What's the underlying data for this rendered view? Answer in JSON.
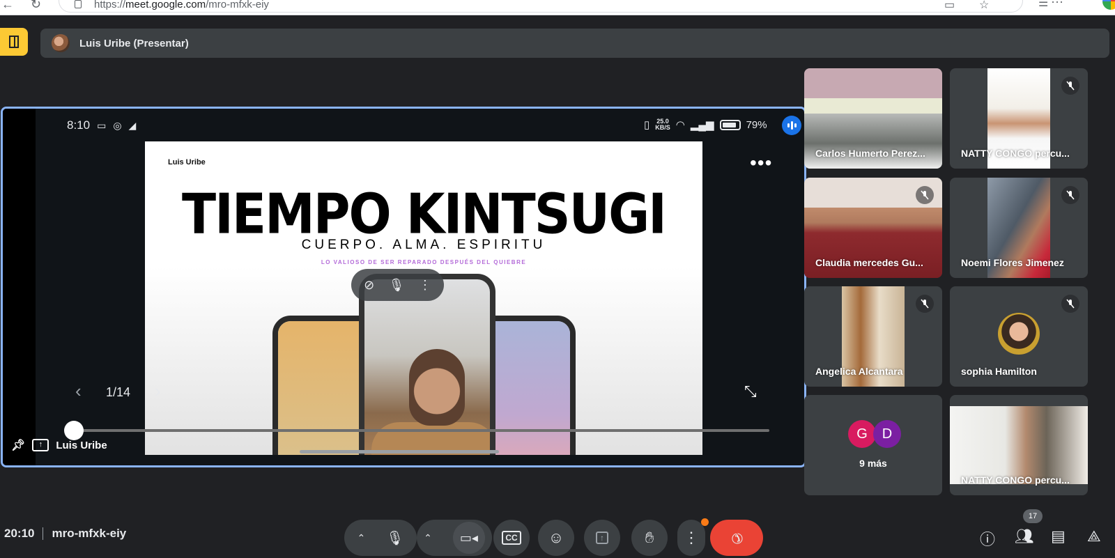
{
  "browser": {
    "url_prefix": "https://",
    "url_host": "meet.google.com",
    "url_path": "/mro-mfxk-eiy"
  },
  "presenter_bar": {
    "label": "Luis Uribe (Presentar)"
  },
  "presentation": {
    "phone_time": "8:10",
    "net_speed_top": "25.0",
    "net_speed_unit": "KB/S",
    "battery": "79%",
    "slide_author": "Luis Uribe",
    "slide_title": "TIEMPO KINTSUGI",
    "slide_subtitle": "CUERPO. ALMA. ESPIRITU",
    "slide_tagline": "LO VALIOSO DE SER REPARADO DESPUÉS DEL QUIEBRE",
    "page_indicator": "1/14",
    "tile_name": "Luis Uribe"
  },
  "participants": [
    {
      "name": "Carlos Humerto Perez...",
      "muted": false
    },
    {
      "name": "NATTY CONGO percu...",
      "muted": true
    },
    {
      "name": "Claudia mercedes Gu...",
      "muted": true
    },
    {
      "name": "Noemi Flores Jimenez",
      "muted": true
    },
    {
      "name": "Angelica Alcantara",
      "muted": true
    },
    {
      "name": "sophia Hamilton",
      "muted": true
    },
    {
      "name": "NATTY CONGO percu...",
      "muted": false
    }
  ],
  "more_tile": {
    "avatars": [
      {
        "letter": "G",
        "color": "#d81b60"
      },
      {
        "letter": "D",
        "color": "#7b1fa2"
      }
    ],
    "label": "9 más"
  },
  "bottom_bar": {
    "time": "20:10",
    "meeting_code": "mro-mfxk-eiy",
    "participants_count": "17"
  },
  "colors": {
    "background": "#202124",
    "tile": "#3c4043",
    "accent": "#8ab4f8",
    "leave": "#ea4335",
    "door": "#fcc934"
  }
}
